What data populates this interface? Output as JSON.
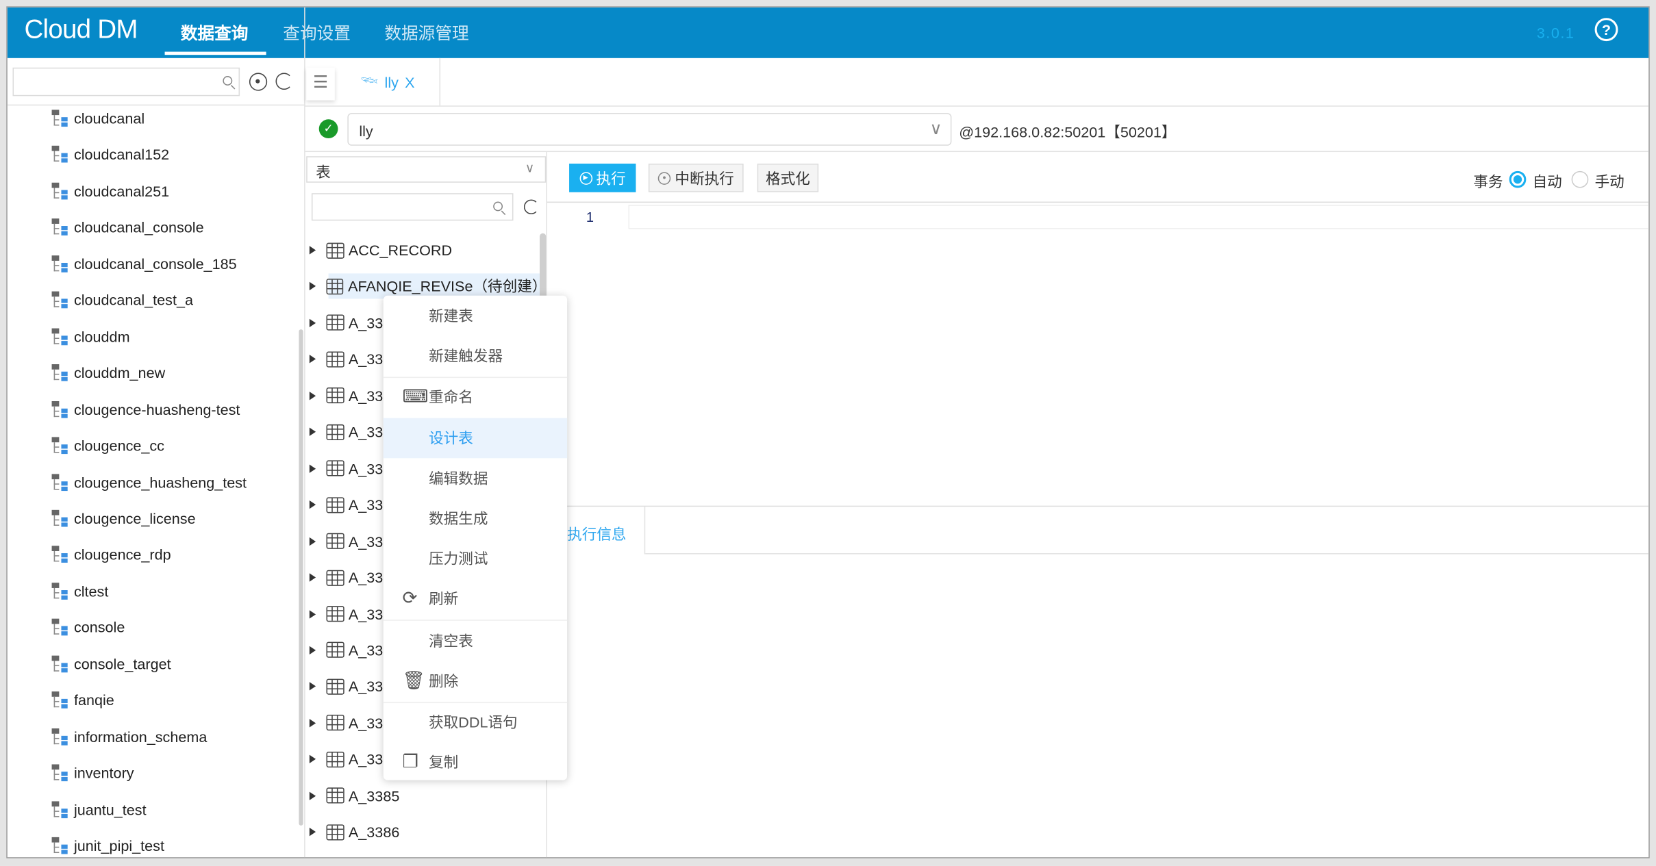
{
  "header": {
    "logo": "Cloud DM",
    "nav": [
      "数据查询",
      "查询设置",
      "数据源管理"
    ],
    "active_nav": 0,
    "version": "3.0.1",
    "help": "?"
  },
  "sidebar": {
    "search_placeholder": "",
    "databases": [
      "cloudcanal",
      "cloudcanal152",
      "cloudcanal251",
      "cloudcanal_console",
      "cloudcanal_console_185",
      "cloudcanal_test_a",
      "clouddm",
      "clouddm_new",
      "clougence-huasheng-test",
      "clougence_cc",
      "clougence_huasheng_test",
      "clougence_license",
      "clougence_rdp",
      "cltest",
      "console",
      "console_target",
      "fanqie",
      "information_schema",
      "inventory",
      "juantu_test",
      "junit_pipi_test"
    ]
  },
  "query_tab": {
    "label": "lly",
    "close": "X"
  },
  "connection": {
    "selected_db": "lly",
    "address": "@192.168.0.82:50201【50201】",
    "status_color": "#1a9a2a"
  },
  "object_panel": {
    "type_select": "表",
    "search_placeholder": "",
    "tables": [
      "ACC_RECORD",
      "AFANQIE_REVISe（待创建）",
      "A_33",
      "A_33",
      "A_33",
      "A_33",
      "A_33",
      "A_33",
      "A_33",
      "A_33",
      "A_33",
      "A_33",
      "A_33",
      "A_33",
      "A_33",
      "A_3385",
      "A_3386"
    ],
    "selected_index": 1
  },
  "toolbar": {
    "execute": "执行",
    "interrupt": "中断执行",
    "format": "格式化",
    "transaction_label": "事务",
    "auto": "自动",
    "manual": "手动",
    "transaction_mode": "auto"
  },
  "editor": {
    "line_numbers": [
      "1"
    ]
  },
  "results": {
    "tab": "执行信息"
  },
  "context_menu": {
    "items": [
      {
        "label": "新建表",
        "icon": ""
      },
      {
        "label": "新建触发器",
        "icon": ""
      },
      {
        "sep": true
      },
      {
        "label": "重命名",
        "icon": "rename-icon"
      },
      {
        "label": "设计表",
        "icon": "",
        "highlight": true
      },
      {
        "label": "编辑数据",
        "icon": ""
      },
      {
        "label": "数据生成",
        "icon": ""
      },
      {
        "label": "压力测试",
        "icon": ""
      },
      {
        "label": "刷新",
        "icon": "refresh-icon"
      },
      {
        "sep": true
      },
      {
        "label": "清空表",
        "icon": ""
      },
      {
        "label": "删除",
        "icon": "trash-icon"
      },
      {
        "sep": true
      },
      {
        "label": "获取DDL语句",
        "icon": ""
      },
      {
        "label": "复制",
        "icon": "copy-icon"
      }
    ]
  },
  "colors": {
    "header": "#0689c8",
    "accent": "#1ab0f0",
    "highlight": "#eaf3fd"
  }
}
